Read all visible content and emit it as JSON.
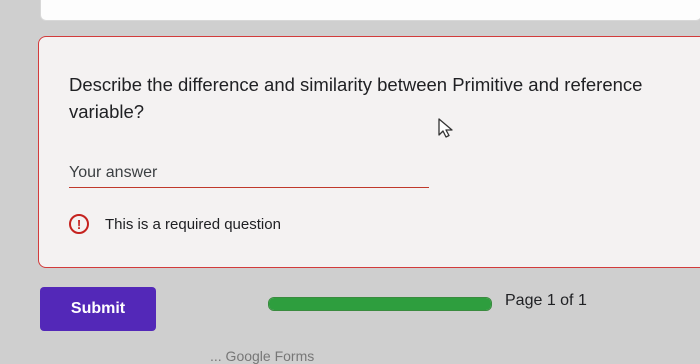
{
  "question": {
    "title": "Describe the difference and similarity between Primitive and reference variable?",
    "answer_placeholder": "Your answer",
    "error_message": "This is a required question",
    "error_icon": "alert-circle-icon"
  },
  "footer": {
    "submit_label": "Submit",
    "progress_fraction": 1.0,
    "page_label": "Page 1 of 1",
    "powered_by_text": "... Google Forms"
  },
  "colors": {
    "accent": "#5328b8",
    "error": "#c5221f",
    "progress": "#2e9e3e"
  }
}
